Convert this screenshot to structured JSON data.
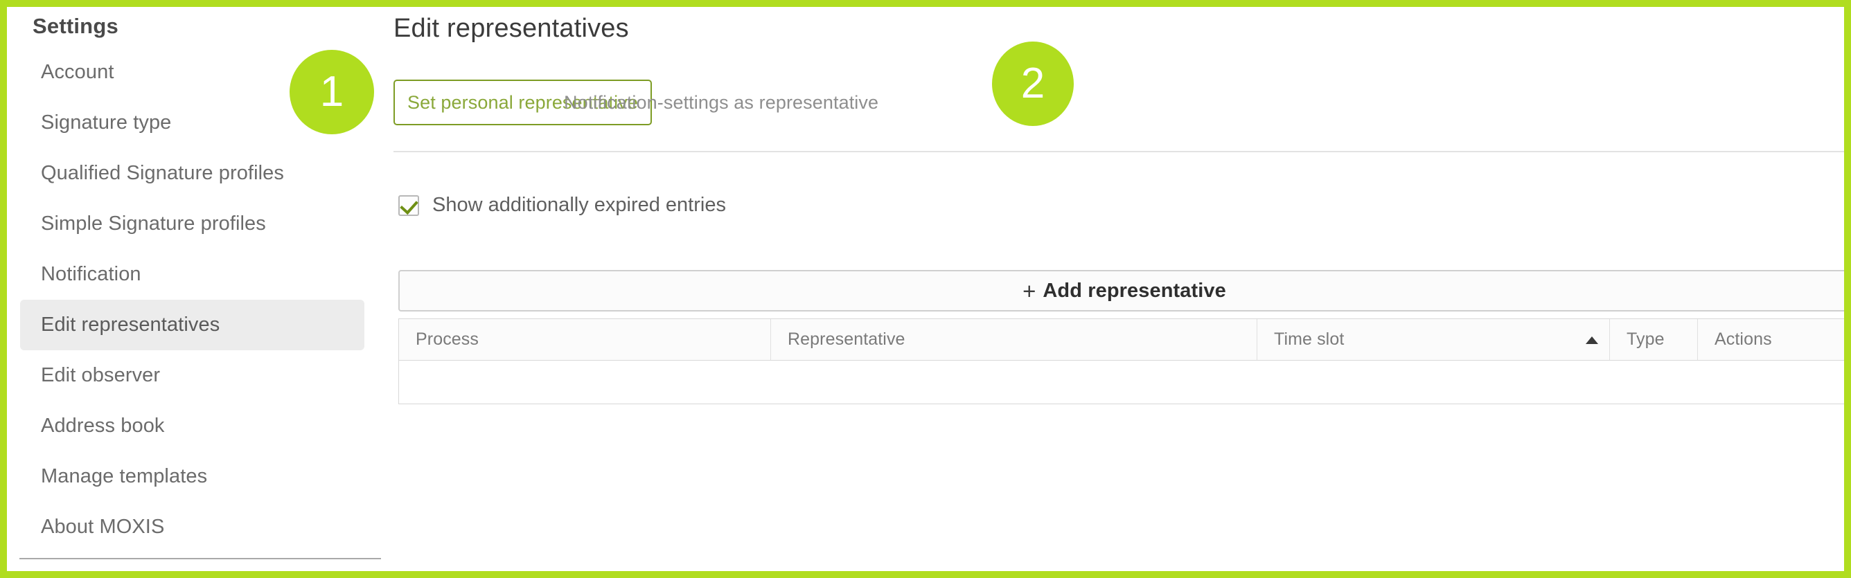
{
  "frame": {
    "accent_color": "#b0dd1f"
  },
  "sidebar": {
    "title": "Settings",
    "items": [
      {
        "label": "Account",
        "active": false
      },
      {
        "label": "Signature type",
        "active": false
      },
      {
        "label": "Qualified Signature profiles",
        "active": false
      },
      {
        "label": "Simple Signature profiles",
        "active": false
      },
      {
        "label": "Notification",
        "active": false
      },
      {
        "label": "Edit representatives",
        "active": true
      },
      {
        "label": "Edit observer",
        "active": false
      },
      {
        "label": "Address book",
        "active": false
      },
      {
        "label": "Manage templates",
        "active": false
      },
      {
        "label": "About MOXIS",
        "active": false
      }
    ]
  },
  "main": {
    "page_title": "Edit representatives",
    "tabs": [
      {
        "label": "Set personal representative",
        "active": true
      },
      {
        "label": "Notification-settings as representative",
        "active": false
      }
    ],
    "checkbox": {
      "label": "Show additionally expired entries",
      "checked": true,
      "check_color": "#6e8f14"
    },
    "add_button": {
      "icon": "plus-icon",
      "plus": "+",
      "label": "Add representative"
    },
    "table": {
      "columns": [
        {
          "label": "Process",
          "sorted": false
        },
        {
          "label": "Representative",
          "sorted": false
        },
        {
          "label": "Time slot",
          "sorted": true,
          "sort_direction": "asc",
          "sort_icon": "caret-up-icon"
        },
        {
          "label": "Type",
          "sorted": false
        },
        {
          "label": "Actions",
          "sorted": false
        }
      ],
      "rows": []
    }
  },
  "callouts": [
    {
      "number": "1",
      "target": "tab-set-personal-representative"
    },
    {
      "number": "2",
      "target": "tab-notification-settings-as-representative"
    }
  ]
}
